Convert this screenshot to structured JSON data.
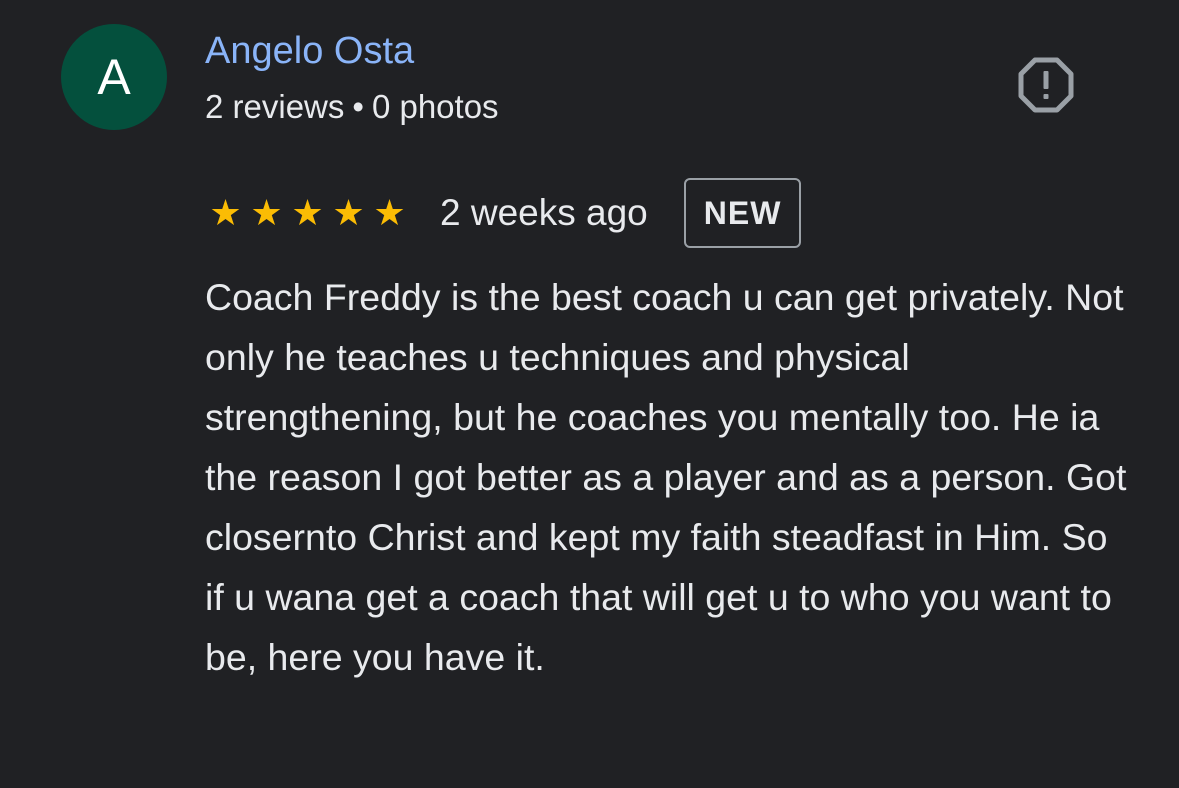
{
  "review": {
    "author": {
      "initial": "A",
      "name": "Angelo Osta",
      "reviews": "2 reviews",
      "separator": "•",
      "photos": "0 photos",
      "avatar_color": "#04503d",
      "name_color": "#8ab4f8"
    },
    "report_icon": "report-flag-octagon-icon",
    "rating": 5,
    "max_rating": 5,
    "star_glyph": "★",
    "star_color": "#fbbc04",
    "time_ago": "2 weeks ago",
    "badge": "NEW",
    "text": "Coach Freddy is the best coach u can get privately. Not only he teaches u techniques and physical strengthening, but he coaches you mentally too. He ia the reason I got better as a player and as a person. Got closernto Christ and kept my faith steadfast in Him. So if u wana get a coach that will get u to who you want to be, here you have it."
  }
}
